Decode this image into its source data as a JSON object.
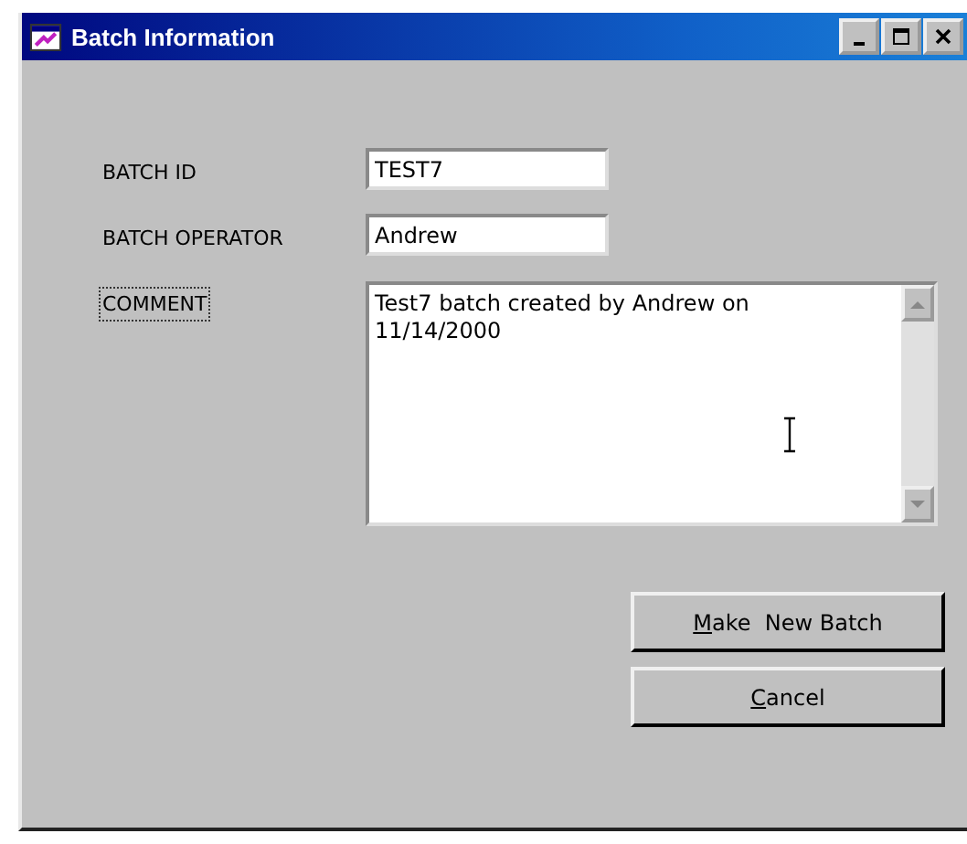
{
  "window": {
    "title": "Batch Information"
  },
  "fields": [
    {
      "kind": "line",
      "label": "BATCH ID",
      "value": "TEST7",
      "focused": false
    },
    {
      "kind": "line",
      "label": "BATCH OPERATOR",
      "value": "Andrew",
      "focused": false
    },
    {
      "kind": "multiline",
      "label": "COMMENT",
      "value": "Test7 batch created by Andrew on 11/14/2000",
      "focused": true
    }
  ],
  "buttons": [
    {
      "label": "Make  New Batch",
      "underline_first": true
    },
    {
      "label": "Cancel",
      "underline_first": true
    }
  ]
}
